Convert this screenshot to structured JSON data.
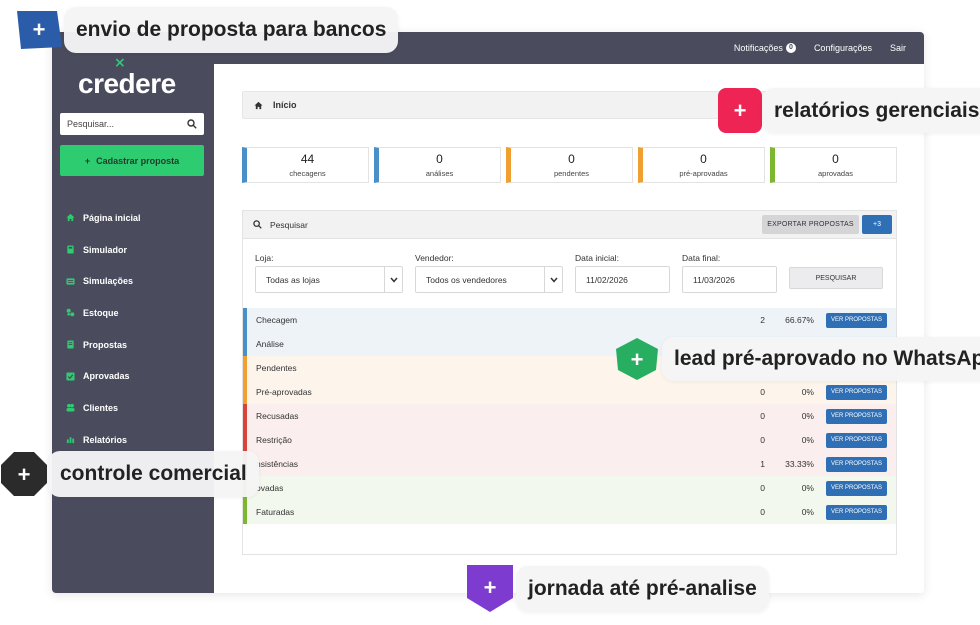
{
  "app": {
    "brand": "credere",
    "topnav": {
      "notifications_label": "Notificações",
      "notifications_count": "0",
      "settings_label": "Configurações",
      "logout_label": "Sair"
    },
    "sidebar": {
      "search_placeholder": "Pesquisar...",
      "cadastrar_label": "Cadastrar proposta",
      "items": [
        {
          "label": "Página inicial",
          "icon": "home-icon"
        },
        {
          "label": "Simulador",
          "icon": "calculator-icon"
        },
        {
          "label": "Simulações",
          "icon": "list-icon"
        },
        {
          "label": "Estoque",
          "icon": "car-icon"
        },
        {
          "label": "Propostas",
          "icon": "document-icon"
        },
        {
          "label": "Aprovadas",
          "icon": "check-icon"
        },
        {
          "label": "Clientes",
          "icon": "users-icon"
        },
        {
          "label": "Relatórios",
          "icon": "chart-icon"
        }
      ]
    },
    "breadcrumb": {
      "label": "Início"
    },
    "stats": [
      {
        "value": "44",
        "label": "checagens",
        "color": "#4a90c8"
      },
      {
        "value": "0",
        "label": "análises",
        "color": "#4a90c8"
      },
      {
        "value": "0",
        "label": "pendentes",
        "color": "#f0a030"
      },
      {
        "value": "0",
        "label": "pré-aprovadas",
        "color": "#f0a030"
      },
      {
        "value": "0",
        "label": "aprovadas",
        "color": "#7cb82f"
      }
    ],
    "panel": {
      "search_label": "Pesquisar",
      "export_label": "EXPORTAR PROPOSTAS",
      "more_label": "+3",
      "filters": {
        "loja_label": "Loja:",
        "loja_value": "Todas as lojas",
        "vendedor_label": "Vendedor:",
        "vendedor_value": "Todos os vendedores",
        "data_inicial_label": "Data inicial:",
        "data_inicial_value": "11/02/2026",
        "data_final_label": "Data final:",
        "data_final_value": "11/03/2026",
        "search_button": "PESQUISAR"
      },
      "rows": [
        {
          "name": "Checagem",
          "count": "2",
          "pct": "66.67%",
          "button": "VER PROPOSTAS",
          "color": "#4a90c8",
          "bg": "#eef3f8"
        },
        {
          "name": "Análise",
          "count": "",
          "pct": "",
          "button": "",
          "color": "#4a90c8",
          "bg": "#eef3f8"
        },
        {
          "name": "Pendentes",
          "count": "",
          "pct": "",
          "button": "",
          "color": "#f0a030",
          "bg": "#fdf5ec"
        },
        {
          "name": "Pré-aprovadas",
          "count": "0",
          "pct": "0%",
          "button": "VER PROPOSTAS",
          "color": "#f0a030",
          "bg": "#fdf5ec"
        },
        {
          "name": "Recusadas",
          "count": "0",
          "pct": "0%",
          "button": "VER PROPOSTAS",
          "color": "#d9443a",
          "bg": "#fbeeee"
        },
        {
          "name": "Restrição",
          "count": "0",
          "pct": "0%",
          "button": "VER PROPOSTAS",
          "color": "#d9443a",
          "bg": "#fbeeee"
        },
        {
          "name": "nsistências",
          "count": "1",
          "pct": "33.33%",
          "button": "VER PROPOSTAS",
          "color": "#d9443a",
          "bg": "#fbeeee"
        },
        {
          "name": "ovadas",
          "count": "0",
          "pct": "0%",
          "button": "VER PROPOSTAS",
          "color": "#7cb82f",
          "bg": "#f3f8ee"
        },
        {
          "name": "Faturadas",
          "count": "0",
          "pct": "0%",
          "button": "VER PROPOSTAS",
          "color": "#7cb82f",
          "bg": "#f3f8ee"
        }
      ]
    }
  },
  "callouts": {
    "envio": {
      "text": "envio de proposta para bancos",
      "color": "#2a5caa"
    },
    "relatorios": {
      "text": "relatórios gerenciais",
      "color": "#ee2454"
    },
    "lead": {
      "text": "lead pré-aprovado no WhatsApp",
      "color": "#27ae60"
    },
    "controle": {
      "text": "controle comercial",
      "color": "#2b2b2b"
    },
    "jornada": {
      "text": "jornada até pré-analise",
      "color": "#7d3bd0"
    }
  }
}
